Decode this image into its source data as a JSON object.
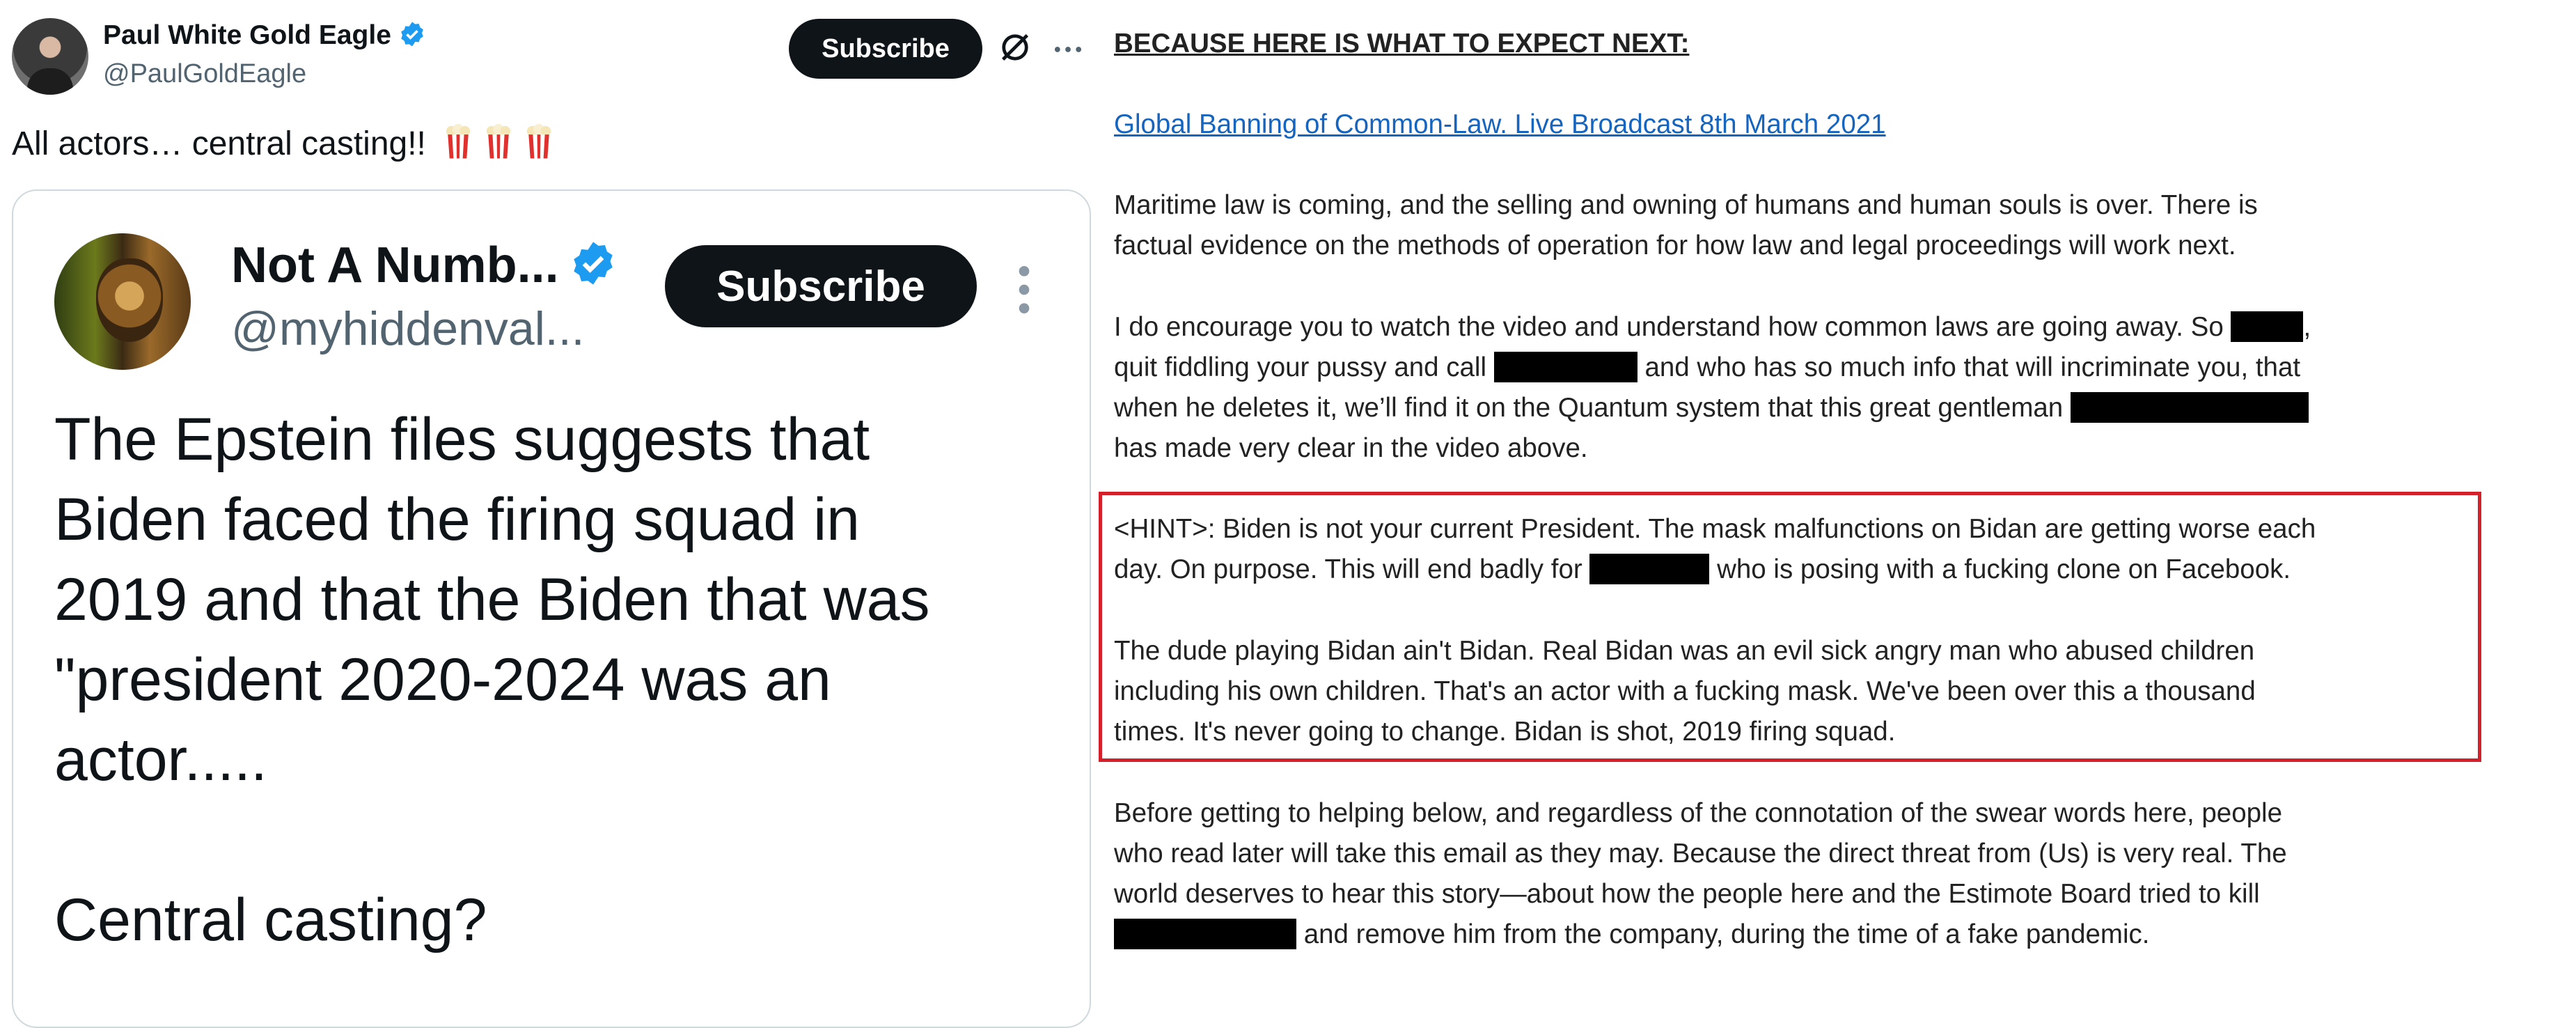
{
  "tweet": {
    "author_name": "Paul White Gold Eagle",
    "author_handle": "@PaulGoldEagle",
    "subscribe_label": "Subscribe",
    "text": "All actors… central casting!!",
    "icons": [
      "verified-badge-icon",
      "grok-icon",
      "more-icon",
      "popcorn-icon"
    ]
  },
  "quoted_tweet": {
    "author_name": "Not A Numb...",
    "author_handle": "@myhiddenval...",
    "subscribe_label": "Subscribe",
    "text": "The Epstein files suggests that\nBiden faced the firing squad in\n2019 and that the Biden that was\n\"president 2020-2024 was an\nactor.....\n\nCentral casting?"
  },
  "document": {
    "heading": "BECAUSE HERE IS WHAT TO EXPECT NEXT:",
    "link": "Global Banning of Common-Law. Live Broadcast 8th March 2021",
    "p1_line1": "Maritime law is coming, and the selling and owning of humans and human souls is over. There is",
    "p1_line2": "factual evidence on the methods of operation for how law and legal proceedings will work next.",
    "p2_line1_a": "I do encourage you to watch the video and understand how common laws are going away. So",
    "p2_line1_b": ",",
    "p2_line2_a": "quit fiddling your pussy and call",
    "p2_line2_b": "and who has so much info that will incriminate you, that",
    "p2_line3": "when he deletes it, we’ll find it on the Quantum system that this great gentleman",
    "p2_line4": "has made very clear in the video above.",
    "hint_line1": "<HINT>: Biden is not your current President. The mask malfunctions on Bidan are getting worse each",
    "hint_line2_a": "day. On purpose. This will end badly for",
    "hint_line2_b": "who is posing with a fucking clone on Facebook.",
    "hint_line3": "The dude playing Bidan ain't Bidan. Real Bidan was an evil sick angry man who abused children",
    "hint_line4": "including his own children. That's an actor with a fucking mask. We've been over this a thousand",
    "hint_line5": "times. It's never going to change. Bidan is shot, 2019 firing squad.",
    "p4_line1": "Before getting to helping below, and regardless of the connotation of the swear words here, people",
    "p4_line2": "who read later will take this email as they may. Because the direct threat from (Us) is very real. The",
    "p4_line3": "world deserves to hear this story—about how the people here and the Estimote Board tried to kill",
    "p4_line4": "and remove him from the company, during the time of a fake pandemic."
  },
  "colors": {
    "verified": "#1d9bf0",
    "link": "#1565c0",
    "hint_border": "#d3202a",
    "button": "#0f1419",
    "secondary_text": "#536471"
  }
}
